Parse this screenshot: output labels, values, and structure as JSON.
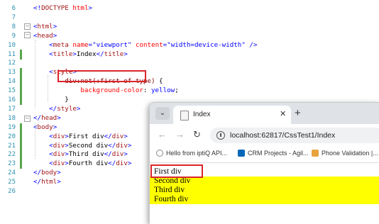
{
  "editor": {
    "lines": [
      {
        "n": "6",
        "html": "<span class='br'>&lt;!</span><span class='tag'>DOCTYPE</span> <span class='attr'>html</span><span class='br'>&gt;</span>"
      },
      {
        "n": "7",
        "html": ""
      },
      {
        "n": "8",
        "html": "<span class='br'>&lt;</span><span class='tag'>html</span><span class='br'>&gt;</span>"
      },
      {
        "n": "9",
        "html": "<span class='br'>&lt;</span><span class='tag'>head</span><span class='br'>&gt;</span>"
      },
      {
        "n": "10",
        "html": "    <span class='br'>&lt;</span><span class='tag'>meta</span> <span class='attr'>name</span><span class='br'>=</span><span class='val'>\"viewport\"</span> <span class='attr'>content</span><span class='br'>=</span><span class='val'>\"width=device-width\"</span> <span class='br'>/&gt;</span>"
      },
      {
        "n": "11",
        "html": "    <span class='br'>&lt;</span><span class='tag'>title</span><span class='br'>&gt;</span><span class='txt'>Index</span><span class='br'>&lt;/</span><span class='tag'>title</span><span class='br'>&gt;</span>"
      },
      {
        "n": "12",
        "html": ""
      },
      {
        "n": "13",
        "html": "    <span class='br'>&lt;</span><span class='tag'>style</span><span class='br'>&gt;</span>"
      },
      {
        "n": "14",
        "html": "        <span class='sel'>div:not(:first-of-type)</span> {"
      },
      {
        "n": "15",
        "html": "            <span class='prop'>background-color</span>: <span class='val'>yellow</span>;"
      },
      {
        "n": "16",
        "html": "        }"
      },
      {
        "n": "17",
        "html": "    <span class='br'>&lt;/</span><span class='tag'>style</span><span class='br'>&gt;</span>"
      },
      {
        "n": "18",
        "html": "<span class='br'>&lt;/</span><span class='tag'>head</span><span class='br'>&gt;</span>"
      },
      {
        "n": "19",
        "html": "<span class='br'>&lt;</span><span class='tag'>body</span><span class='br'>&gt;</span>"
      },
      {
        "n": "20",
        "html": "    <span class='br'>&lt;</span><span class='tag'>div</span><span class='br'>&gt;</span><span class='txt'>First div</span><span class='br'>&lt;/</span><span class='tag'>div</span><span class='br'>&gt;</span>"
      },
      {
        "n": "21",
        "html": "    <span class='br'>&lt;</span><span class='tag'>div</span><span class='br'>&gt;</span><span class='txt'>Second div</span><span class='br'>&lt;/</span><span class='tag'>div</span><span class='br'>&gt;</span>"
      },
      {
        "n": "22",
        "html": "    <span class='br'>&lt;</span><span class='tag'>div</span><span class='br'>&gt;</span><span class='txt'>Third div</span><span class='br'>&lt;/</span><span class='tag'>div</span><span class='br'>&gt;</span>"
      },
      {
        "n": "23",
        "html": "    <span class='br'>&lt;</span><span class='tag'>div</span><span class='br'>&gt;</span><span class='txt'>Fourth div</span><span class='br'>&lt;/</span><span class='tag'>div</span><span class='br'>&gt;</span>"
      },
      {
        "n": "24",
        "html": "<span class='br'>&lt;/</span><span class='tag'>body</span><span class='br'>&gt;</span>"
      },
      {
        "n": "25",
        "html": "<span class='br'>&lt;/</span><span class='tag'>html</span><span class='br'>&gt;</span>"
      },
      {
        "n": "26",
        "html": ""
      }
    ],
    "fold_symbol": "−"
  },
  "browser": {
    "tab_menu_icon": "chevron-down",
    "tab_menu_glyph": "⌄",
    "tab_title": "Index",
    "tab_close_glyph": "✕",
    "new_tab_glyph": "+",
    "back_glyph": "←",
    "forward_glyph": "→",
    "reload_glyph": "↻",
    "url": "localhost:62817/CssTest1/Index",
    "bookmarks": [
      {
        "label": "Hello from iptiQ API...",
        "icon": "globe-icon"
      },
      {
        "label": "CRM Projects - Agil...",
        "icon": "crm-icon"
      },
      {
        "label": "Phone Validation |...",
        "icon": "bookmark-icon"
      }
    ],
    "content_rows": [
      {
        "text": "First div",
        "highlight": false
      },
      {
        "text": "Second div",
        "highlight": true
      },
      {
        "text": "Third div",
        "highlight": true
      },
      {
        "text": "Fourth div",
        "highlight": true
      }
    ],
    "highlight_color": "#ffff00"
  },
  "annotation_color": "#d9262b"
}
